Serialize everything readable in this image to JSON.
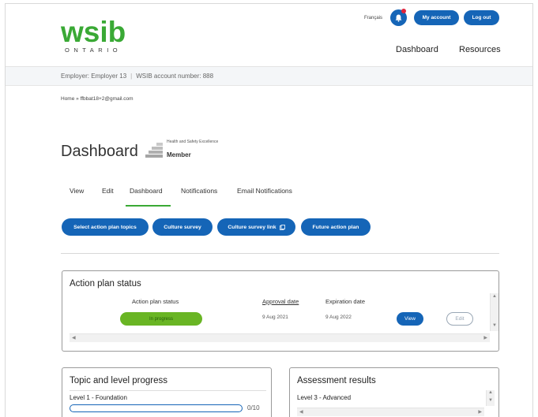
{
  "header": {
    "logo_main": "wsib",
    "logo_sub": "ONTARIO",
    "language_link": "Français",
    "my_account_label": "My account",
    "logout_label": "Log out",
    "nav": [
      "Dashboard",
      "Resources"
    ]
  },
  "employer_strip": {
    "employer": "Employer: Employer 13",
    "separator": "|",
    "account": "WSIB account number: 888"
  },
  "breadcrumb": "Home » ffbbat18+2@gmail.com",
  "page": {
    "title": "Dashboard",
    "badge_line1": "Health and Safety Excellence",
    "badge_line2": "Member"
  },
  "tabs": [
    "View",
    "Edit",
    "Dashboard",
    "Notifications",
    "Email Notifications"
  ],
  "action_buttons": [
    "Select action plan topics",
    "Culture survey",
    "Culture survey link",
    "Future action plan"
  ],
  "action_plan_status": {
    "title": "Action plan status",
    "columns": [
      "Action plan status",
      "Approval date",
      "Expiration date"
    ],
    "row": {
      "status": "In progress",
      "approval_date": "9 Aug 2021",
      "expiration_date": "9 Aug 2022",
      "view_label": "View",
      "edit_label": "Edit"
    }
  },
  "topic_progress": {
    "title": "Topic and level progress",
    "level_label": "Level 1 - Foundation",
    "count": "0/10",
    "progress_fraction": 0
  },
  "assessment_results": {
    "title": "Assessment results",
    "level_label": "Level 3 - Advanced"
  },
  "colors": {
    "brand_green": "#3aa935",
    "primary_blue": "#1565b7",
    "status_green": "#69b524",
    "notification_red": "#e0243c"
  }
}
